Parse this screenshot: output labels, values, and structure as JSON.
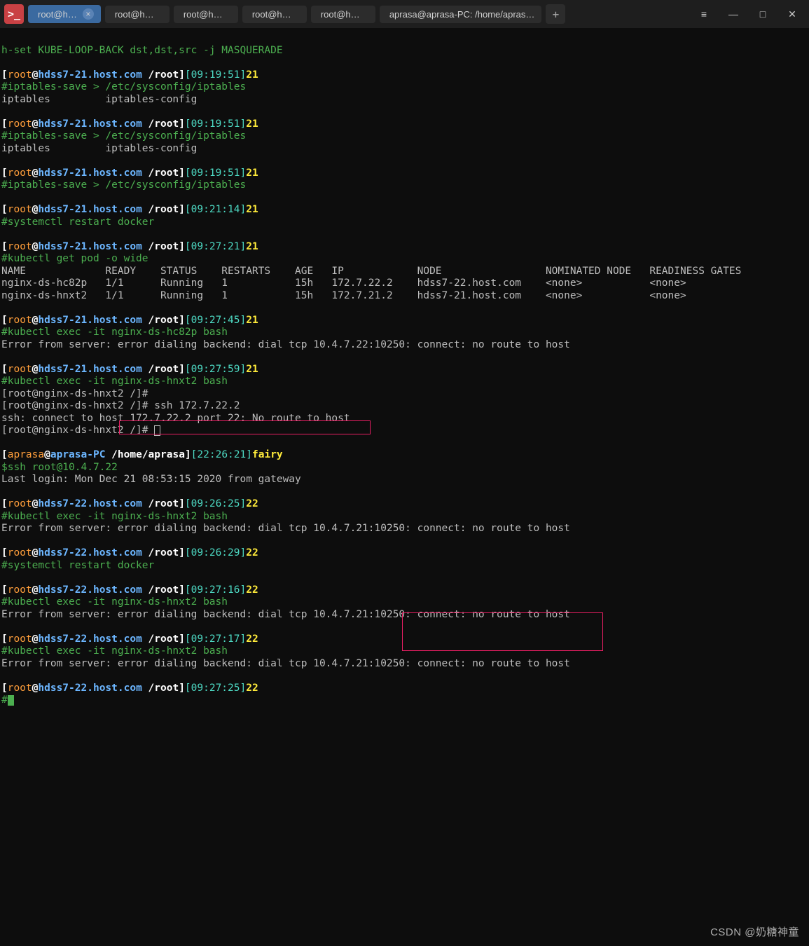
{
  "titlebar": {
    "tabs": [
      {
        "label": "root@h…",
        "active": true,
        "close": true
      },
      {
        "label": "root@h…",
        "active": false,
        "close": false
      },
      {
        "label": "root@h…",
        "active": false,
        "close": false
      },
      {
        "label": "root@h…",
        "active": false,
        "close": false
      },
      {
        "label": "root@h…",
        "active": false,
        "close": false
      },
      {
        "label": "aprasa@aprasa-PC: /home/apras…",
        "active": false,
        "close": false
      }
    ],
    "newtab": "+",
    "menu": "≡",
    "min": "—",
    "max": "□",
    "close": "✕"
  },
  "prompt": {
    "user21": "root",
    "host21": "hdss7-21.host.com",
    "user22": "root",
    "host22": "hdss7-22.host.com",
    "userA": "aprasa",
    "hostA": "aprasa-PC",
    "pathRoot": "/root",
    "pathHome": "/home/aprasa",
    "at": "@",
    "lb": "[",
    "rb": "]",
    "num21": "21",
    "num22": "22",
    "fairy": "fairy"
  },
  "times": {
    "t1": "[09:19:51]",
    "t2": "[09:19:51]",
    "t3": "[09:19:51]",
    "t4": "[09:21:14]",
    "t5": "[09:27:21]",
    "t6": "[09:27:45]",
    "t7": "[09:27:59]",
    "tA": "[22:26:21]",
    "t8": "[09:26:25]",
    "t9": "[09:26:29]",
    "t10": "[09:27:16]",
    "t11": "[09:27:17]",
    "t12": "[09:27:25]"
  },
  "lines": {
    "l0": "h-set KUBE-LOOP-BACK dst,dst,src -j MASQUERADE",
    "ipsave": "#iptables-save > /etc/sysconfig/iptables",
    "ipcfg": "iptables         iptables-config",
    "sysctl": "#systemctl restart docker",
    "kget": "#kubectl get pod -o wide",
    "khdr": "NAME             READY    STATUS    RESTARTS    AGE   IP            NODE                 NOMINATED NODE   READINESS GATES",
    "kr1": "nginx-ds-hc82p   1/1      Running   1           15h   172.7.22.2    hdss7-22.host.com    <none>           <none>",
    "kr2": "nginx-ds-hnxt2   1/1      Running   1           15h   172.7.21.2    hdss7-21.host.com    <none>           <none>",
    "exec1": "#kubectl exec -it nginx-ds-hc82p bash",
    "err22": "Error from server: error dialing backend: dial tcp 10.4.7.22:10250: connect: no route to host",
    "exec2": "#kubectl exec -it nginx-ds-hnxt2 bash",
    "nginxP1": "[root@nginx-ds-hnxt2 /]#",
    "nginxP2": "[root@nginx-ds-hnxt2 /]# ssh 172.7.22.2",
    "sshe": "ssh: connect to host 172.7.22.2 port 22: No route to host",
    "nginxP3": "[root@nginx-ds-hnxt2 /]# ",
    "sshcmd": "$ssh root@10.4.7.22",
    "last": "Last login: Mon Dec 21 08:53:15 2020 from gateway",
    "err21": "Error from server: error dialing backend: dial tcp 10.4.7.21:10250: connect: no route to host",
    "hash": "#"
  },
  "watermark": "CSDN @奶糖神童"
}
